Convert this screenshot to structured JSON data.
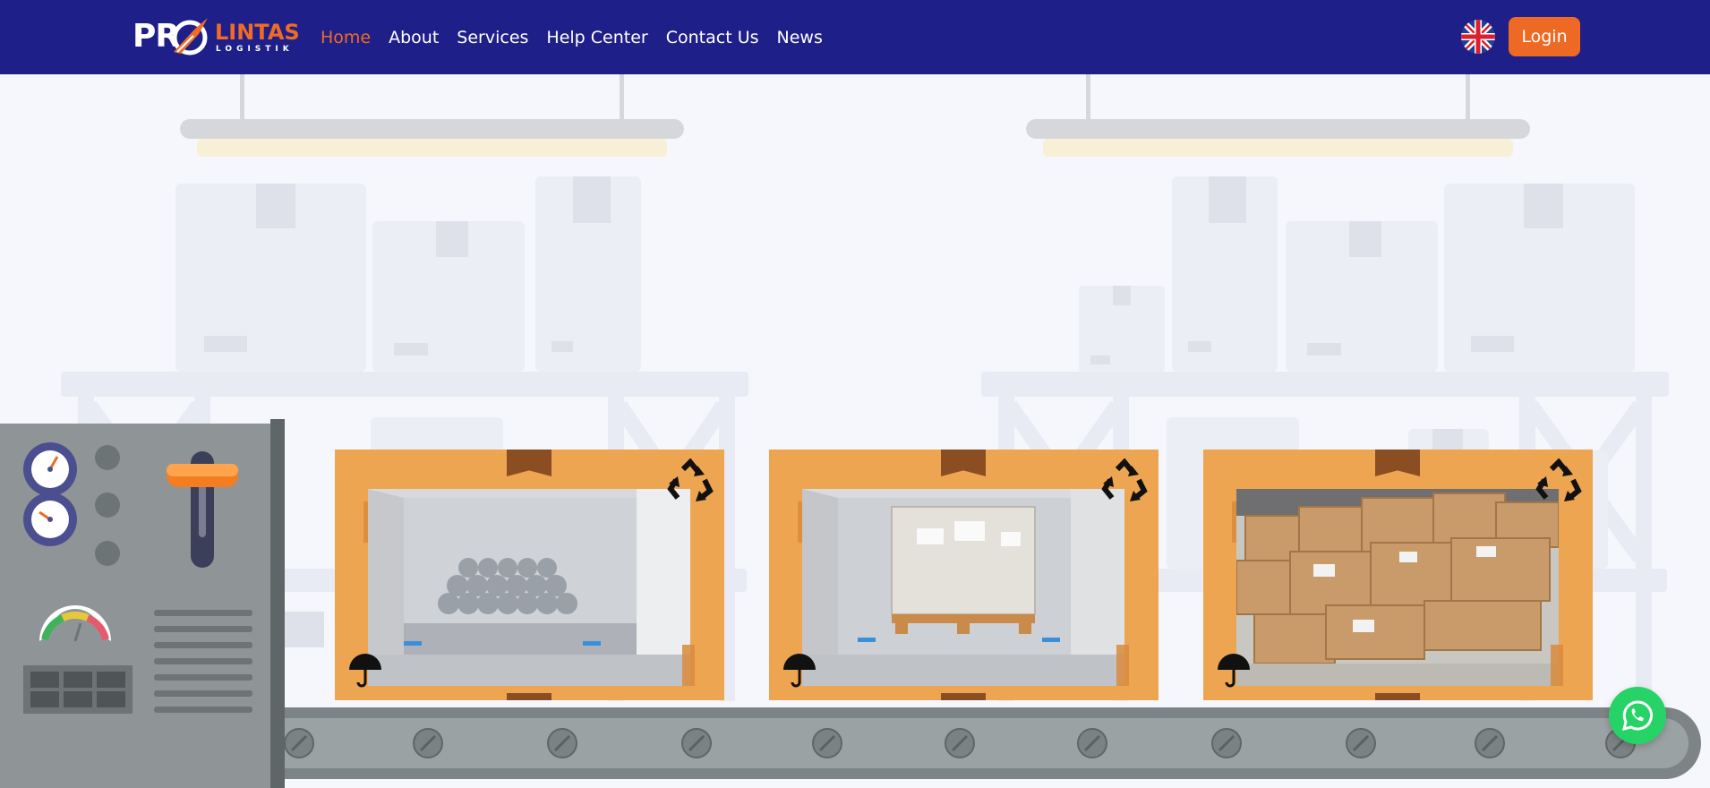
{
  "brand": {
    "logo_main": "PR",
    "logo_accent": "LINTAS",
    "logo_sub": "LOGISTIK",
    "colors": {
      "navy": "#1f1f8a",
      "orange": "#f06b24",
      "whatsapp": "#26d366"
    }
  },
  "nav": {
    "items": [
      {
        "label": "Home",
        "active": true
      },
      {
        "label": "About"
      },
      {
        "label": "Services"
      },
      {
        "label": "Help Center"
      },
      {
        "label": "Contact Us"
      },
      {
        "label": "News"
      }
    ]
  },
  "header": {
    "language_icon": "uk-flag-icon",
    "login_label": "Login"
  },
  "hero": {
    "cards": [
      {
        "icon_top": "recycle-icon",
        "icon_bottom": "umbrella-icon",
        "photo": "truck-cargo-rolls"
      },
      {
        "icon_top": "recycle-icon",
        "icon_bottom": "umbrella-icon",
        "photo": "truck-cargo-pallet"
      },
      {
        "icon_top": "recycle-icon",
        "icon_bottom": "umbrella-icon",
        "photo": "cardboard-boxes-stack"
      }
    ]
  },
  "floating": {
    "whatsapp_icon": "whatsapp-icon"
  }
}
